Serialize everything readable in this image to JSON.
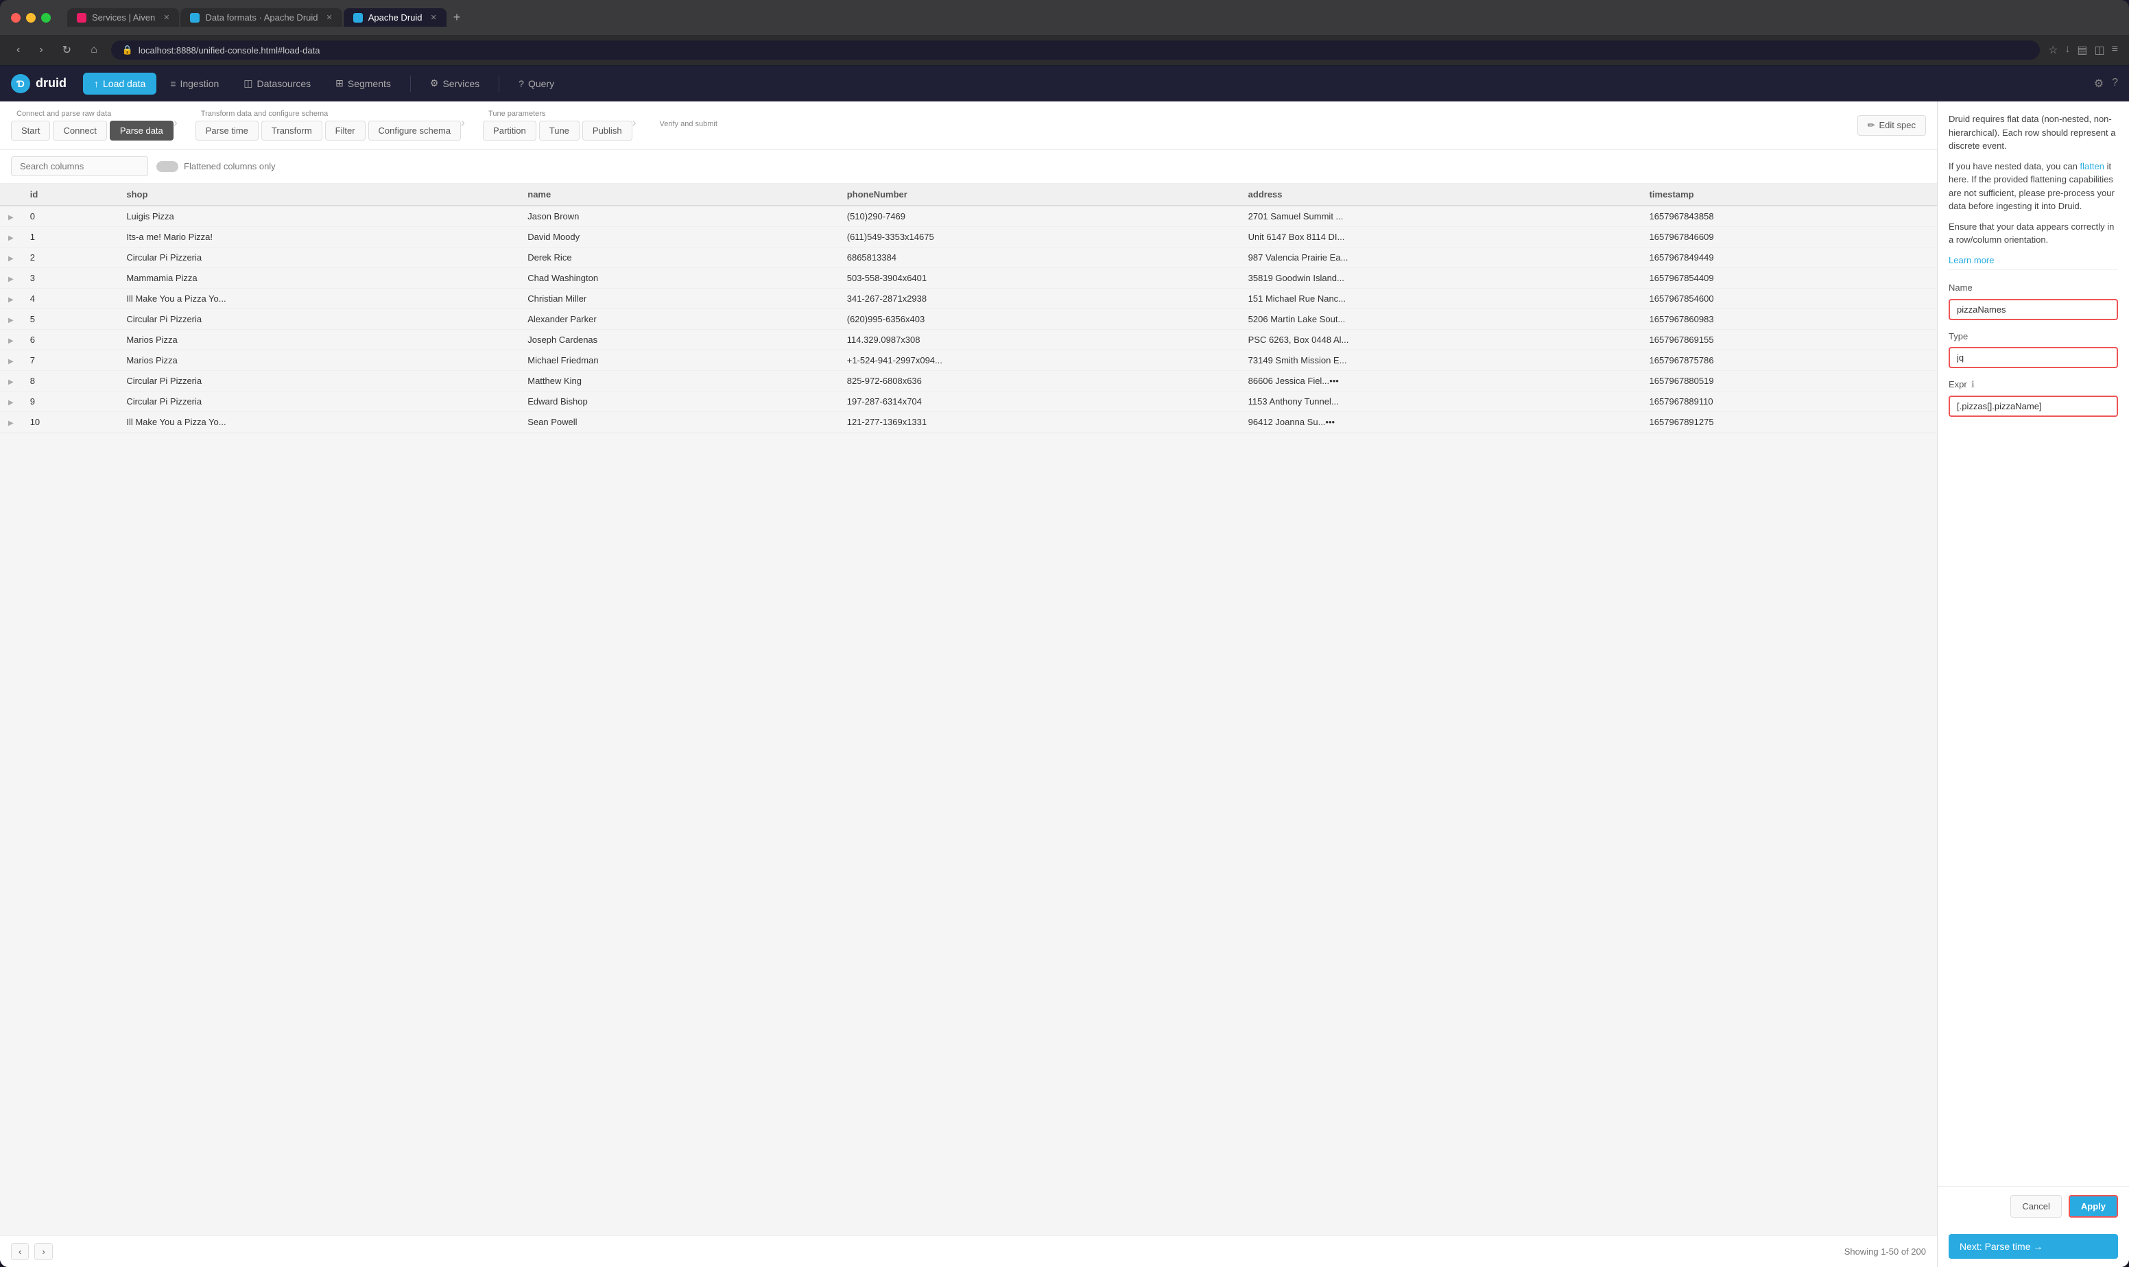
{
  "browser": {
    "tabs": [
      {
        "id": "tab1",
        "favicon_color": "#e91e63",
        "label": "Services | Aiven",
        "active": false
      },
      {
        "id": "tab2",
        "favicon_color": "#29abe2",
        "label": "Data formats · Apache Druid",
        "active": false
      },
      {
        "id": "tab3",
        "favicon_color": "#29abe2",
        "label": "Apache Druid",
        "active": true
      }
    ],
    "url": "localhost:8888/unified-console.html#load-data",
    "nav": {
      "back": "‹",
      "forward": "›",
      "reload": "↻",
      "home": "⌂"
    }
  },
  "app": {
    "logo": "D",
    "logo_text": "druid",
    "nav_items": [
      {
        "id": "load-data",
        "label": "Load data",
        "active": true,
        "icon": "↑"
      },
      {
        "id": "ingestion",
        "label": "Ingestion",
        "active": false,
        "icon": "≡"
      },
      {
        "id": "datasources",
        "label": "Datasources",
        "active": false,
        "icon": "◫"
      },
      {
        "id": "segments",
        "label": "Segments",
        "active": false,
        "icon": "⊞"
      },
      {
        "id": "services",
        "label": "Services",
        "active": false,
        "icon": "⚙"
      },
      {
        "id": "query",
        "label": "Query",
        "active": false,
        "icon": "?"
      }
    ]
  },
  "wizard": {
    "groups": [
      {
        "label": "Connect and parse raw data",
        "steps": [
          "Start",
          "Connect",
          "Parse data"
        ]
      },
      {
        "label": "Transform data and configure schema",
        "steps": [
          "Parse time",
          "Transform",
          "Filter",
          "Configure schema"
        ]
      },
      {
        "label": "Tune parameters",
        "steps": [
          "Partition",
          "Tune",
          "Publish"
        ]
      },
      {
        "label": "Verify and submit",
        "steps": []
      }
    ],
    "active_step": "Parse data",
    "edit_spec_label": "Edit spec"
  },
  "search": {
    "placeholder": "Search columns",
    "toggle_label": "Flattened columns only"
  },
  "table": {
    "columns": [
      "",
      "id",
      "shop",
      "name",
      "phoneNumber",
      "address",
      "timestamp"
    ],
    "rows": [
      {
        "expand": "▶",
        "id": "0",
        "shop": "Luigis Pizza",
        "name": "Jason Brown",
        "phoneNumber": "(510)290-7469",
        "address": "2701 Samuel Summit ...",
        "timestamp": "1657967843858"
      },
      {
        "expand": "▶",
        "id": "1",
        "shop": "Its-a me! Mario Pizza!",
        "name": "David Moody",
        "phoneNumber": "(611)549-3353x14675",
        "address": "Unit 6147 Box 8114 DI...",
        "timestamp": "1657967846609"
      },
      {
        "expand": "▶",
        "id": "2",
        "shop": "Circular Pi Pizzeria",
        "name": "Derek Rice",
        "phoneNumber": "6865813384",
        "address": "987 Valencia Prairie Ea...",
        "timestamp": "1657967849449"
      },
      {
        "expand": "▶",
        "id": "3",
        "shop": "Mammamia Pizza",
        "name": "Chad Washington",
        "phoneNumber": "503-558-3904x6401",
        "address": "35819 Goodwin Island...",
        "timestamp": "1657967854409"
      },
      {
        "expand": "▶",
        "id": "4",
        "shop": "Ill Make You a Pizza Yo...",
        "name": "Christian Miller",
        "phoneNumber": "341-267-2871x2938",
        "address": "151 Michael Rue Nanc...",
        "timestamp": "1657967854600"
      },
      {
        "expand": "▶",
        "id": "5",
        "shop": "Circular Pi Pizzeria",
        "name": "Alexander Parker",
        "phoneNumber": "(620)995-6356x403",
        "address": "5206 Martin Lake Sout...",
        "timestamp": "1657967860983"
      },
      {
        "expand": "▶",
        "id": "6",
        "shop": "Marios Pizza",
        "name": "Joseph Cardenas",
        "phoneNumber": "114.329.0987x308",
        "address": "PSC 6263, Box 0448 Al...",
        "timestamp": "1657967869155"
      },
      {
        "expand": "▶",
        "id": "7",
        "shop": "Marios Pizza",
        "name": "Michael Friedman",
        "phoneNumber": "+1-524-941-2997x094...",
        "address": "73149 Smith Mission E...",
        "timestamp": "1657967875786"
      },
      {
        "expand": "▶",
        "id": "8",
        "shop": "Circular Pi Pizzeria",
        "name": "Matthew King",
        "phoneNumber": "825-972-6808x636",
        "address": "86606 Jessica Fiel...•••",
        "timestamp": "1657967880519"
      },
      {
        "expand": "▶",
        "id": "9",
        "shop": "Circular Pi Pizzeria",
        "name": "Edward Bishop",
        "phoneNumber": "197-287-6314x704",
        "address": "1153 Anthony Tunnel...",
        "timestamp": "1657967889110"
      },
      {
        "expand": "▶",
        "id": "10",
        "shop": "Ill Make You a Pizza Yo...",
        "name": "Sean Powell",
        "phoneNumber": "121-277-1369x1331",
        "address": "96412 Joanna Su...•••",
        "timestamp": "1657967891275"
      }
    ],
    "footer": {
      "showing": "Showing 1-50 of 200"
    }
  },
  "right_panel": {
    "description_parts": [
      "Druid requires flat data (non-nested, non-hierarchical). Each row should represent a discrete event.",
      "If you have nested data, you can",
      "flatten",
      "it here. If the provided flattening capabilities are not sufficient, please pre-process your data before ingesting it into Druid.",
      "Ensure that your data appears correctly in a row/column orientation.",
      "Learn more"
    ],
    "form": {
      "name_label": "Name",
      "name_value": "pizzaNames",
      "type_label": "Type",
      "type_value": "jq",
      "expr_label": "Expr",
      "expr_value": "[.pizzas[].pizzaName]",
      "cancel_label": "Cancel",
      "apply_label": "Apply"
    },
    "next_label": "Next: Parse time →"
  }
}
